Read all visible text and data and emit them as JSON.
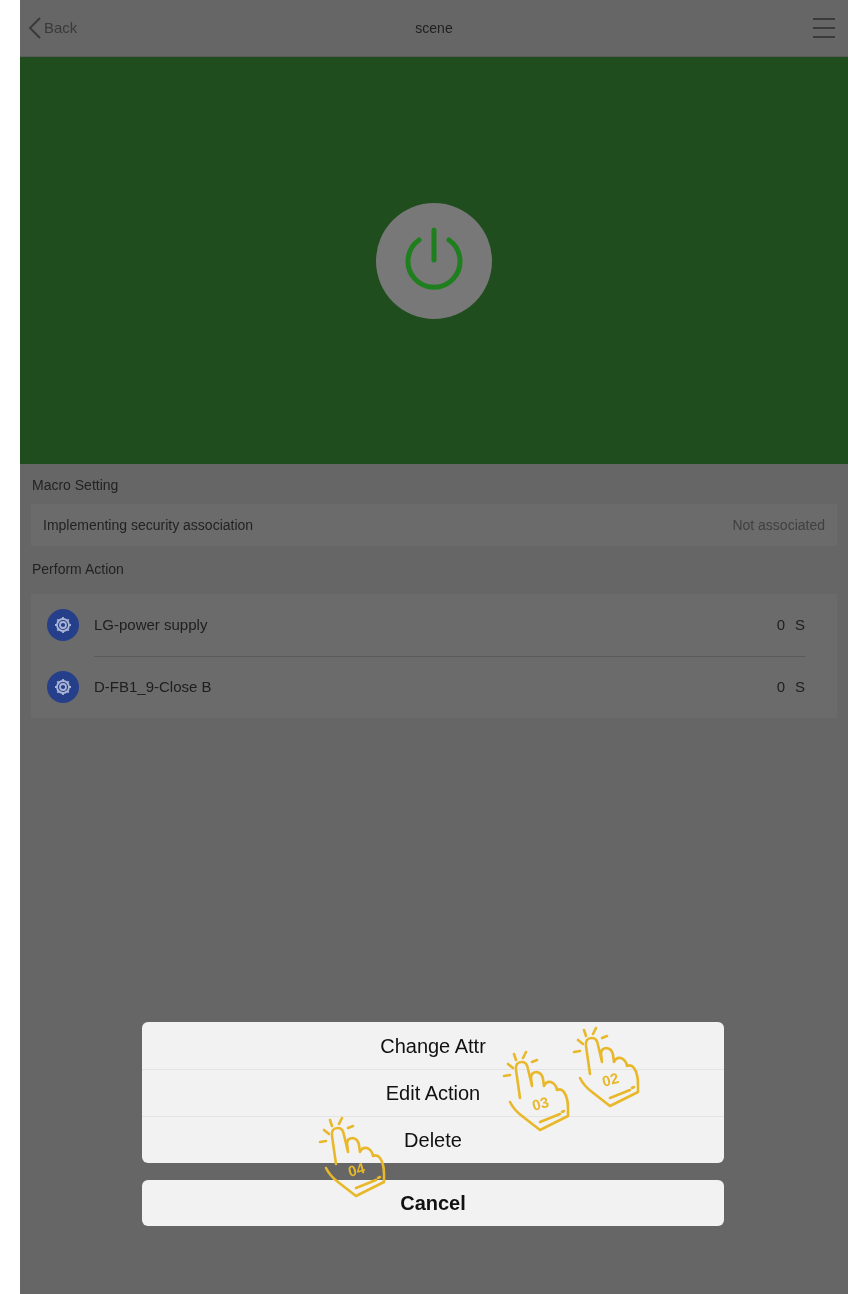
{
  "nav": {
    "back": "Back",
    "title": "scene"
  },
  "macro_setting": {
    "heading": "Macro Setting",
    "rows": [
      {
        "label": "Implementing security association",
        "value": "Not associated"
      }
    ]
  },
  "perform_action": {
    "heading": "Perform Action",
    "items": [
      {
        "name": "LG-power supply",
        "delay": "0",
        "unit": "S"
      },
      {
        "name": "D-FB1_9-Close B",
        "delay": "0",
        "unit": "S"
      }
    ]
  },
  "action_sheet": {
    "options": [
      "Change Attr",
      "Edit Action",
      "Delete"
    ],
    "cancel": "Cancel"
  },
  "tap_markers": [
    {
      "label": "02"
    },
    {
      "label": "03"
    },
    {
      "label": "04"
    }
  ]
}
